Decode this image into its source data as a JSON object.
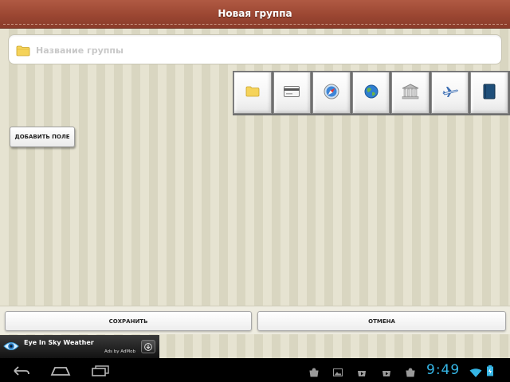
{
  "header": {
    "title": "Новая группа"
  },
  "group_name": {
    "value": "",
    "placeholder": "Название группы",
    "icon": "folder-icon"
  },
  "icon_picker": {
    "icons": [
      "folder-icon",
      "card-icon",
      "safari-icon",
      "globe-icon",
      "bank-icon",
      "airplane-icon",
      "book-icon"
    ]
  },
  "add_field": {
    "label": "ДОБАВИТЬ ПОЛЕ"
  },
  "actions": {
    "save_label": "СОХРАНИТЬ",
    "cancel_label": "ОТМЕНА"
  },
  "ad": {
    "title": "Eye In Sky Weather",
    "by": "Ads by AdMob"
  },
  "system": {
    "time": "9:49",
    "accent": "#35b5e5"
  },
  "colors": {
    "titlebar": "#9b4632",
    "stripe_light": "#e6e3d1",
    "stripe_dark": "#d9d6c1"
  }
}
